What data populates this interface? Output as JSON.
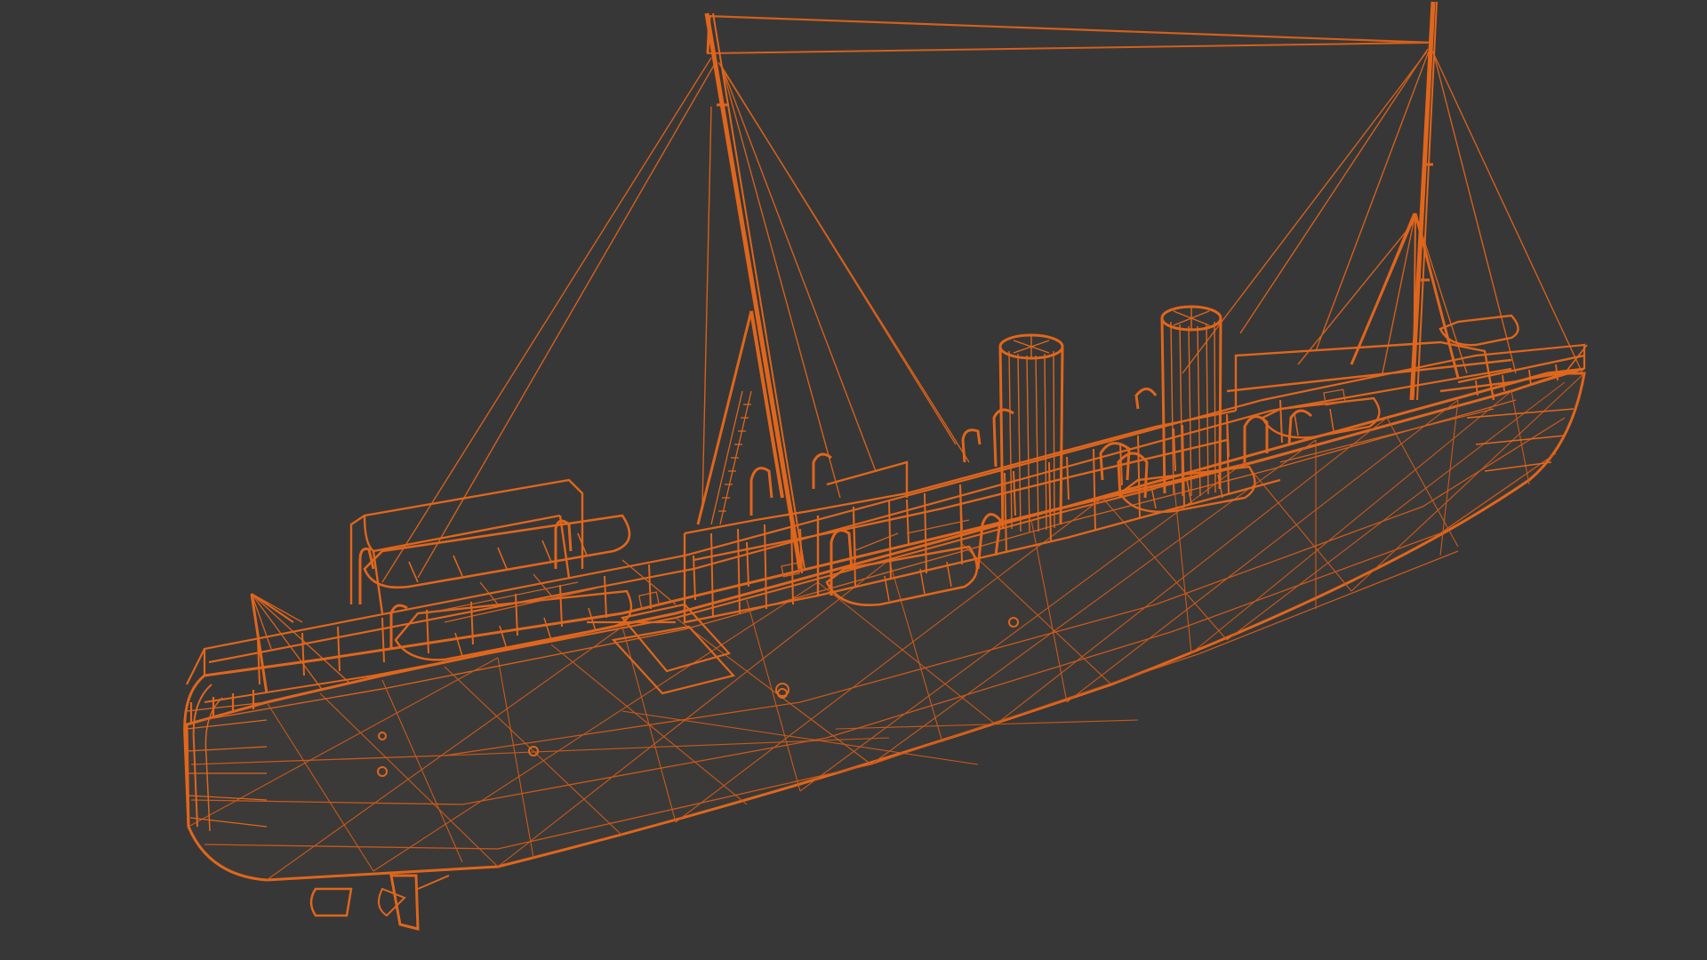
{
  "viewport": {
    "background_color": "#373737",
    "render_mode": "wireframe",
    "object": "steamship model",
    "wire_color": "#e0661c",
    "wire_color_dark": "#b9531a",
    "wire_color_bright": "#f07a2e"
  }
}
